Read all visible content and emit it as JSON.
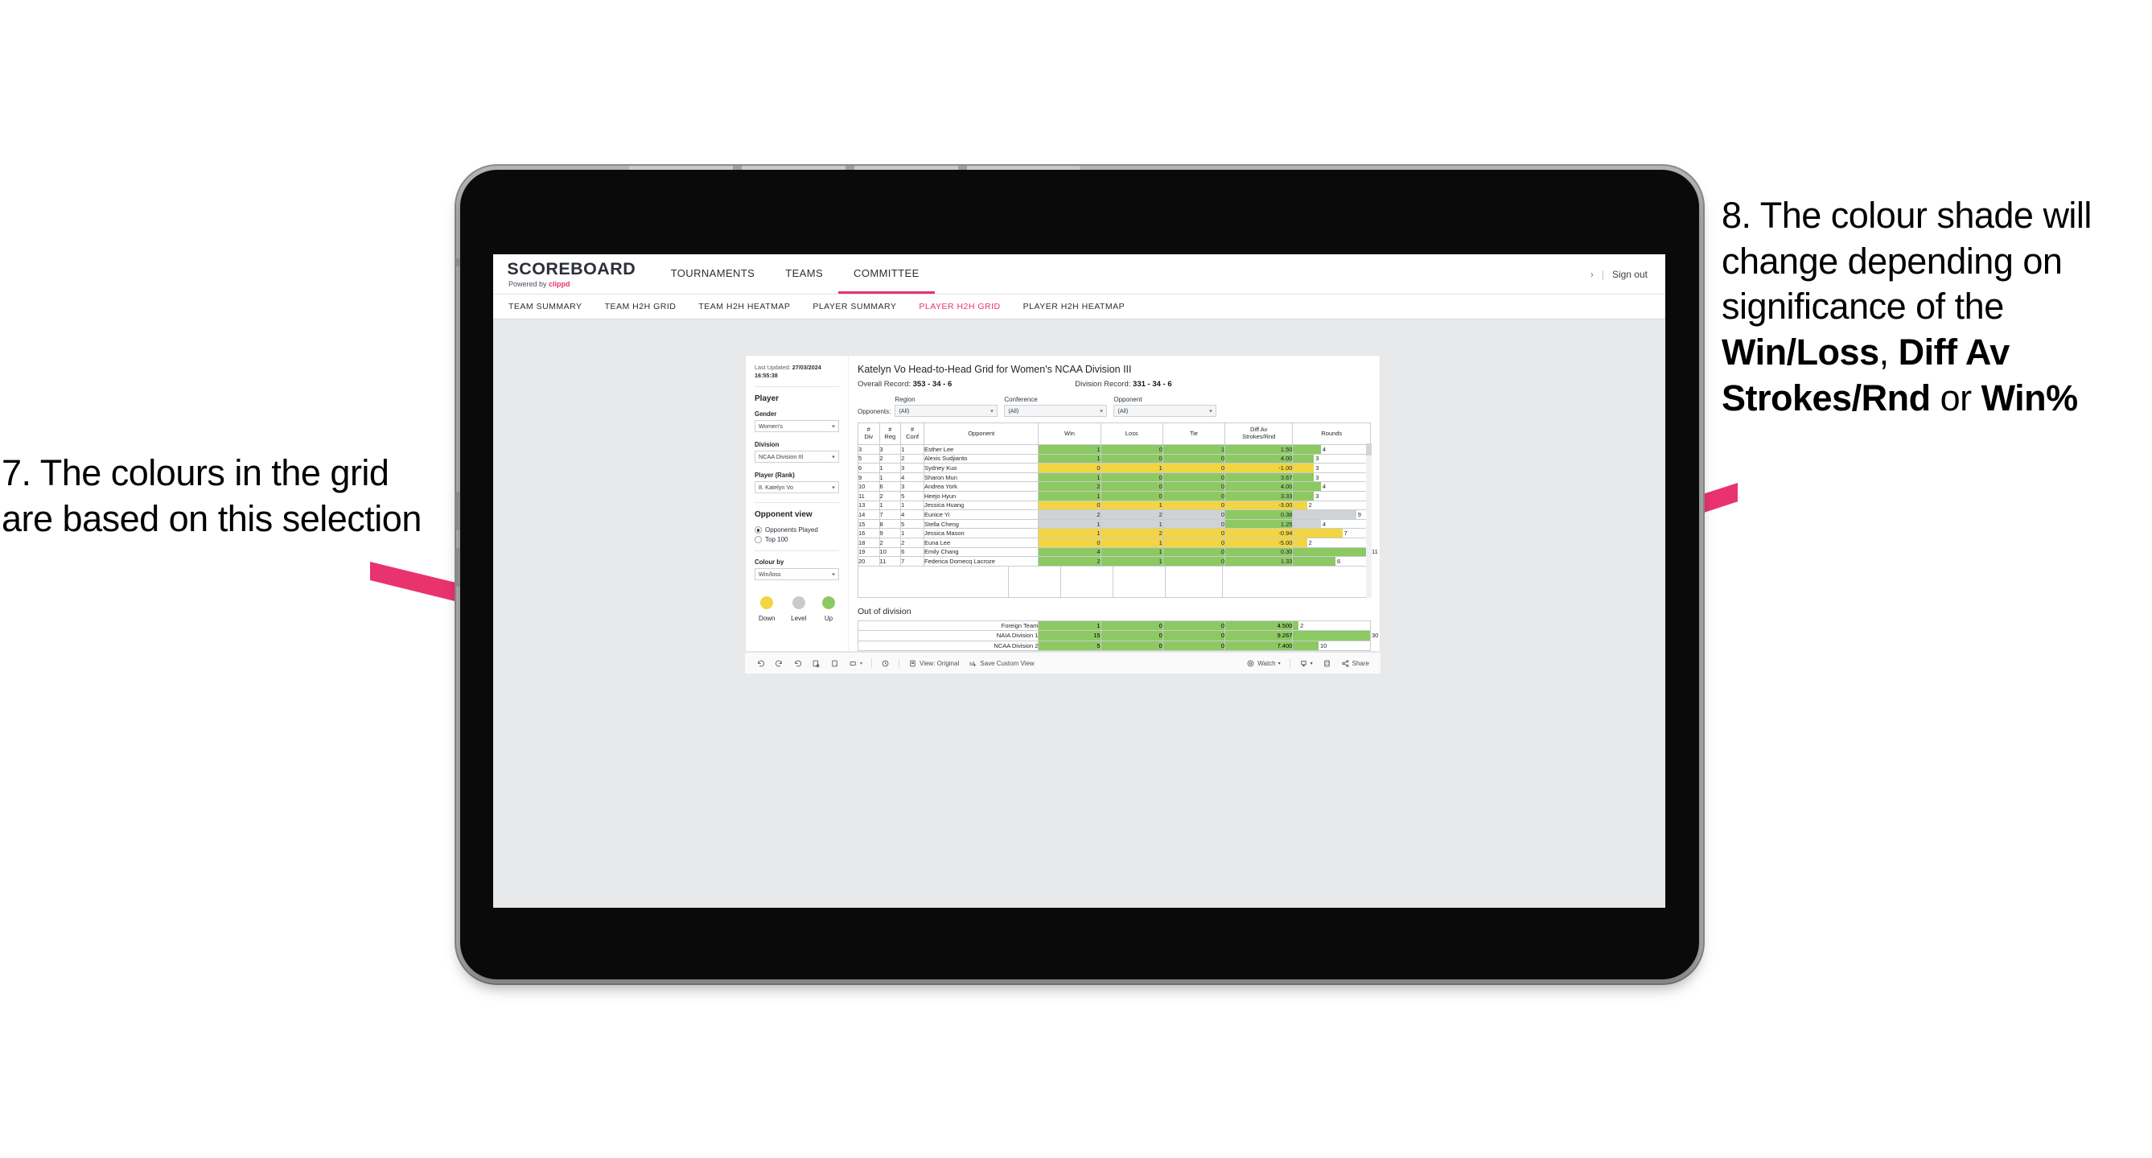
{
  "annotations": {
    "left": "7. The colours in the grid are based on this selection",
    "right_pre": "8. The colour shade will change depending on significance of the ",
    "right_b1": "Win/Loss",
    "right_mid1": ", ",
    "right_b2": "Diff Av Strokes/Rnd",
    "right_mid2": " or ",
    "right_b3": "Win%",
    "arrow_color": "#E8336E"
  },
  "topnav": {
    "logo_main": "SCOREBOARD",
    "logo_sub_pre": "Powered by ",
    "logo_brand": "clippd",
    "items": [
      {
        "label": "TOURNAMENTS",
        "active": false
      },
      {
        "label": "TEAMS",
        "active": false
      },
      {
        "label": "COMMITTEE",
        "active": true
      }
    ],
    "chevron": "›",
    "divider": "|",
    "sign_out": "Sign out"
  },
  "subnav": {
    "items": [
      {
        "label": "TEAM SUMMARY",
        "active": false
      },
      {
        "label": "TEAM H2H GRID",
        "active": false
      },
      {
        "label": "TEAM H2H HEATMAP",
        "active": false
      },
      {
        "label": "PLAYER SUMMARY",
        "active": false
      },
      {
        "label": "PLAYER H2H GRID",
        "active": true
      },
      {
        "label": "PLAYER H2H HEATMAP",
        "active": false
      }
    ]
  },
  "sidebar": {
    "updated_label": "Last Updated: ",
    "updated_date": "27/03/2024",
    "updated_time": "16:55:38",
    "player_heading": "Player",
    "gender_label": "Gender",
    "gender_value": "Women's",
    "division_label": "Division",
    "division_value": "NCAA Division III",
    "player_rank_label": "Player (Rank)",
    "player_rank_value": "8. Katelyn Vo",
    "opponent_view_heading": "Opponent view",
    "opponent_view_options": [
      {
        "label": "Opponents Played",
        "selected": true
      },
      {
        "label": "Top 100",
        "selected": false
      }
    ],
    "colour_by_label": "Colour by",
    "colour_by_value": "Win/loss",
    "legend": [
      {
        "label": "Down",
        "color": "#F2D541"
      },
      {
        "label": "Level",
        "color": "#C8CBCC"
      },
      {
        "label": "Up",
        "color": "#8DC963"
      }
    ]
  },
  "main": {
    "title": "Katelyn Vo Head-to-Head Grid for Women's NCAA Division III",
    "overall_record_label": "Overall Record: ",
    "overall_record_value": "353 - 34 - 6",
    "division_record_label": "Division Record: ",
    "division_record_value": "331 - 34 - 6",
    "opponents_label": "Opponents:",
    "filters": [
      {
        "caption": "Region",
        "value": "(All)"
      },
      {
        "caption": "Conference",
        "value": "(All)"
      },
      {
        "caption": "Opponent",
        "value": "(All)"
      }
    ],
    "columns": [
      "# Div",
      "# Reg",
      "# Conf",
      "Opponent",
      "Win",
      "Loss",
      "Tie",
      "Diff Av Strokes/Rnd",
      "Rounds"
    ],
    "column_lines": [
      [
        "#",
        "Div"
      ],
      [
        "#",
        "Reg"
      ],
      [
        "#",
        "Conf"
      ],
      [
        "Opponent",
        ""
      ],
      [
        "Win",
        ""
      ],
      [
        "Loss",
        ""
      ],
      [
        "Tie",
        ""
      ],
      [
        "Diff Av",
        "Strokes/Rnd"
      ],
      [
        "Rounds",
        ""
      ]
    ],
    "ood_title": "Out of division"
  },
  "chart_data": {
    "type": "table",
    "title": "Katelyn Vo Head-to-Head Grid for Women's NCAA Division III",
    "columns": [
      "# Div",
      "# Reg",
      "# Conf",
      "Opponent",
      "Win",
      "Loss",
      "Tie",
      "Diff Av Strokes/Rnd",
      "Rounds"
    ],
    "rounds_max": 11,
    "colors": {
      "up": "#8DC963",
      "level": "#D0D3D6",
      "down": "#F2D541"
    },
    "rows": [
      {
        "div": "3",
        "reg": "3",
        "conf": "1",
        "opponent": "Esther Lee",
        "win": "1",
        "loss": "0",
        "tie": "1",
        "diff": "1.50",
        "rounds": "4",
        "rounds_n": 4,
        "shade": "up"
      },
      {
        "div": "5",
        "reg": "2",
        "conf": "2",
        "opponent": "Alexis Sudjianto",
        "win": "1",
        "loss": "0",
        "tie": "0",
        "diff": "4.00",
        "rounds": "3",
        "rounds_n": 3,
        "shade": "up"
      },
      {
        "div": "6",
        "reg": "1",
        "conf": "3",
        "opponent": "Sydney Kuo",
        "win": "0",
        "loss": "1",
        "tie": "0",
        "diff": "-1.00",
        "rounds": "3",
        "rounds_n": 3,
        "shade": "down"
      },
      {
        "div": "9",
        "reg": "1",
        "conf": "4",
        "opponent": "Sharon Mun",
        "win": "1",
        "loss": "0",
        "tie": "0",
        "diff": "3.67",
        "rounds": "3",
        "rounds_n": 3,
        "shade": "up"
      },
      {
        "div": "10",
        "reg": "6",
        "conf": "3",
        "opponent": "Andrea York",
        "win": "2",
        "loss": "0",
        "tie": "0",
        "diff": "4.00",
        "rounds": "4",
        "rounds_n": 4,
        "shade": "up"
      },
      {
        "div": "11",
        "reg": "2",
        "conf": "5",
        "opponent": "Heejo Hyun",
        "win": "1",
        "loss": "0",
        "tie": "0",
        "diff": "3.33",
        "rounds": "3",
        "rounds_n": 3,
        "shade": "up"
      },
      {
        "div": "13",
        "reg": "1",
        "conf": "1",
        "opponent": "Jessica Huang",
        "win": "0",
        "loss": "1",
        "tie": "0",
        "diff": "-3.00",
        "rounds": "2",
        "rounds_n": 2,
        "shade": "down"
      },
      {
        "div": "14",
        "reg": "7",
        "conf": "4",
        "opponent": "Eunice Yi",
        "win": "2",
        "loss": "2",
        "tie": "0",
        "diff": "0.38",
        "rounds": "9",
        "rounds_n": 9,
        "shade": "level",
        "diff_shade": "up"
      },
      {
        "div": "15",
        "reg": "8",
        "conf": "5",
        "opponent": "Stella Cheng",
        "win": "1",
        "loss": "1",
        "tie": "0",
        "diff": "1.25",
        "rounds": "4",
        "rounds_n": 4,
        "shade": "level",
        "diff_shade": "up"
      },
      {
        "div": "16",
        "reg": "9",
        "conf": "1",
        "opponent": "Jessica Mason",
        "win": "1",
        "loss": "2",
        "tie": "0",
        "diff": "-0.94",
        "rounds": "7",
        "rounds_n": 7,
        "shade": "down"
      },
      {
        "div": "18",
        "reg": "2",
        "conf": "2",
        "opponent": "Euna Lee",
        "win": "0",
        "loss": "1",
        "tie": "0",
        "diff": "-5.00",
        "rounds": "2",
        "rounds_n": 2,
        "shade": "down"
      },
      {
        "div": "19",
        "reg": "10",
        "conf": "6",
        "opponent": "Emily Chang",
        "win": "4",
        "loss": "1",
        "tie": "0",
        "diff": "0.30",
        "rounds": "11",
        "rounds_n": 11,
        "shade": "up"
      },
      {
        "div": "20",
        "reg": "11",
        "conf": "7",
        "opponent": "Federica Domecq Lacroze",
        "win": "2",
        "loss": "1",
        "tie": "0",
        "diff": "1.33",
        "rounds": "6",
        "rounds_n": 6,
        "shade": "up"
      }
    ],
    "out_of_division": {
      "title": "Out of division",
      "rounds_max": 30,
      "rows": [
        {
          "name": "Foreign Team",
          "win": "1",
          "loss": "0",
          "tie": "0",
          "diff": "4.500",
          "rounds": "2",
          "rounds_n": 2,
          "shade": "up"
        },
        {
          "name": "NAIA Division 1",
          "win": "15",
          "loss": "0",
          "tie": "0",
          "diff": "9.267",
          "rounds": "30",
          "rounds_n": 30,
          "shade": "up"
        },
        {
          "name": "NCAA Division 2",
          "win": "5",
          "loss": "0",
          "tie": "0",
          "diff": "7.400",
          "rounds": "10",
          "rounds_n": 10,
          "shade": "up"
        }
      ]
    }
  },
  "toolbar": {
    "view_original": "View: Original",
    "save_custom_view": "Save Custom View",
    "watch": "Watch",
    "share": "Share",
    "caret": "▾"
  }
}
